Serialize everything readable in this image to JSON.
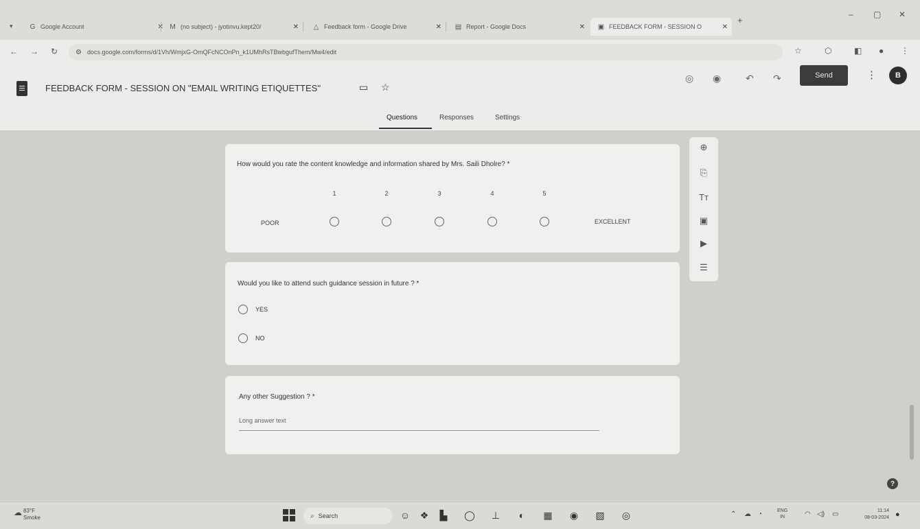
{
  "browser": {
    "tabs": [
      {
        "label": "Google Account",
        "icon": "google-icon"
      },
      {
        "label": "(no subject) - jyotinvu.kept20/",
        "icon": "gmail-icon"
      },
      {
        "label": "Feedback form - Google Drive",
        "icon": "drive-icon"
      },
      {
        "label": "Report - Google Docs",
        "icon": "docs-icon"
      },
      {
        "label": "FEEDBACK FORM - SESSION O",
        "icon": "forms-icon"
      }
    ],
    "url": "docs.google.com/forms/d/1Vh/WmjxG-OmQFcNCOnPn_k1UMhRsTBwbgufThem/Mw4/edit"
  },
  "form": {
    "title": "FEEDBACK FORM - SESSION ON \"EMAIL WRITING ETIQUETTES\"",
    "send_label": "Send",
    "avatar_letter": "B",
    "tabs": [
      "Questions",
      "Responses",
      "Settings"
    ]
  },
  "questions": [
    {
      "title": "How would you rate the content knowledge and information shared by Mrs. Saili Dholre? *",
      "scale": [
        "1",
        "2",
        "3",
        "4",
        "5"
      ],
      "low_label": "POOR",
      "high_label": "EXCELLENT"
    },
    {
      "title": "Would you like to attend such guidance session in future ? *",
      "options": [
        "YES",
        "NO"
      ]
    },
    {
      "title": "Any other Suggestion ? *",
      "placeholder": "Long answer text"
    }
  ],
  "taskbar": {
    "weather_temp": "83°F",
    "weather_desc": "Smoke",
    "search_label": "Search",
    "lang_top": "ENG",
    "lang_bottom": "IN",
    "time": "11:14",
    "date": "08-03-2024"
  }
}
